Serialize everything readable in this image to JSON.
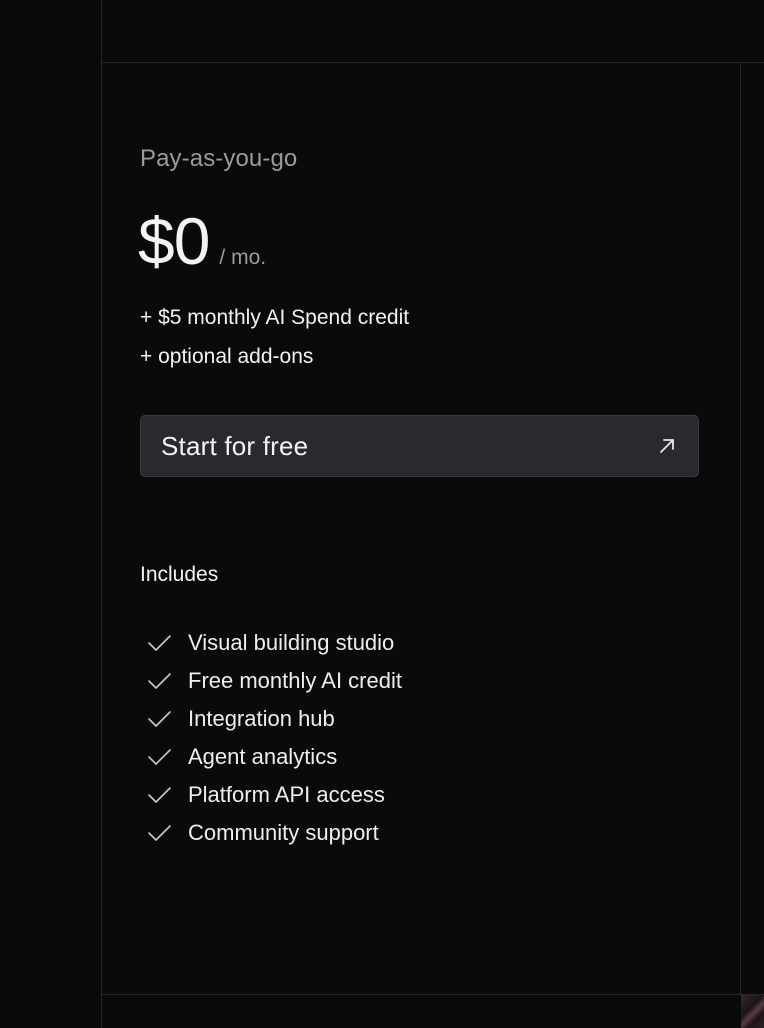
{
  "plan": {
    "name": "Pay-as-you-go",
    "price": "$0",
    "period": "/ mo.",
    "extras": [
      "+ $5 monthly AI Spend credit",
      "+ optional add-ons"
    ],
    "cta_label": "Start for free",
    "cta_icon": "arrow-up-right-icon"
  },
  "includes": {
    "title": "Includes",
    "check_icon": "check-icon",
    "features": [
      "Visual building studio",
      "Free monthly AI credit",
      "Integration hub",
      "Agent analytics",
      "Platform API access",
      "Community support"
    ]
  },
  "colors": {
    "background": "#0a0a0b",
    "border": "#26262a",
    "button_bg": "#2a2a2e",
    "muted_text": "#9a9aa2",
    "text": "#f2f2f3"
  }
}
